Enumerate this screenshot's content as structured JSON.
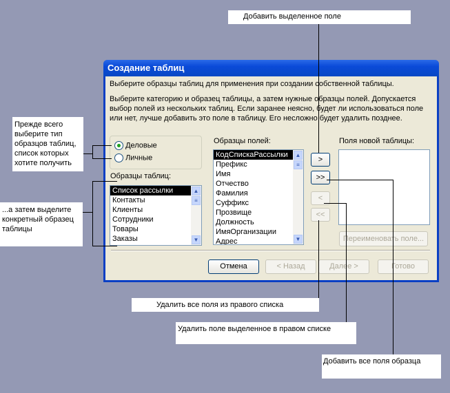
{
  "callouts": {
    "add_selected": "Добавить выделенное поле",
    "choose_type": "Прежде всего выберите тип образцов таблиц, список которых хотите получить",
    "select_sample": "...а затем выделите конкретный образец таблицы",
    "remove_all": "Удалить все поля из правого списка",
    "remove_selected": "Удалить поле выделенное в правом списке",
    "add_all": "Добавить все поля образца"
  },
  "dialog": {
    "title": "Создание таблиц",
    "intro": "Выберите образцы таблиц для применения при создании собственной таблицы.",
    "description": "Выберите категорию и образец таблицы, а затем нужные образцы полей. Допускается выбор полей из нескольких таблиц. Если заранее неясно, будет ли использоваться поле или нет, лучше добавить это поле в таблицу. Его несложно будет удалить позднее.",
    "radio_business": "Деловые",
    "radio_personal": "Личные",
    "tables_label": "Образцы таблиц:",
    "tables": [
      "Список рассылки",
      "Контакты",
      "Клиенты",
      "Сотрудники",
      "Товары",
      "Заказы"
    ],
    "fields_label": "Образцы полей:",
    "fields": [
      "КодСпискаРассылки",
      "Префикс",
      "Имя",
      "Отчество",
      "Фамилия",
      "Суффикс",
      "Прозвище",
      "Должность",
      "ИмяОрганизации",
      "Адрес"
    ],
    "new_fields_label": "Поля новой таблицы:",
    "btn_add": ">",
    "btn_add_all": ">>",
    "btn_remove": "<",
    "btn_remove_all": "<<",
    "btn_rename": "Переименовать поле...",
    "btn_cancel": "Отмена",
    "btn_back": "< Назад",
    "btn_next": "Далее >",
    "btn_finish": "Готово"
  }
}
